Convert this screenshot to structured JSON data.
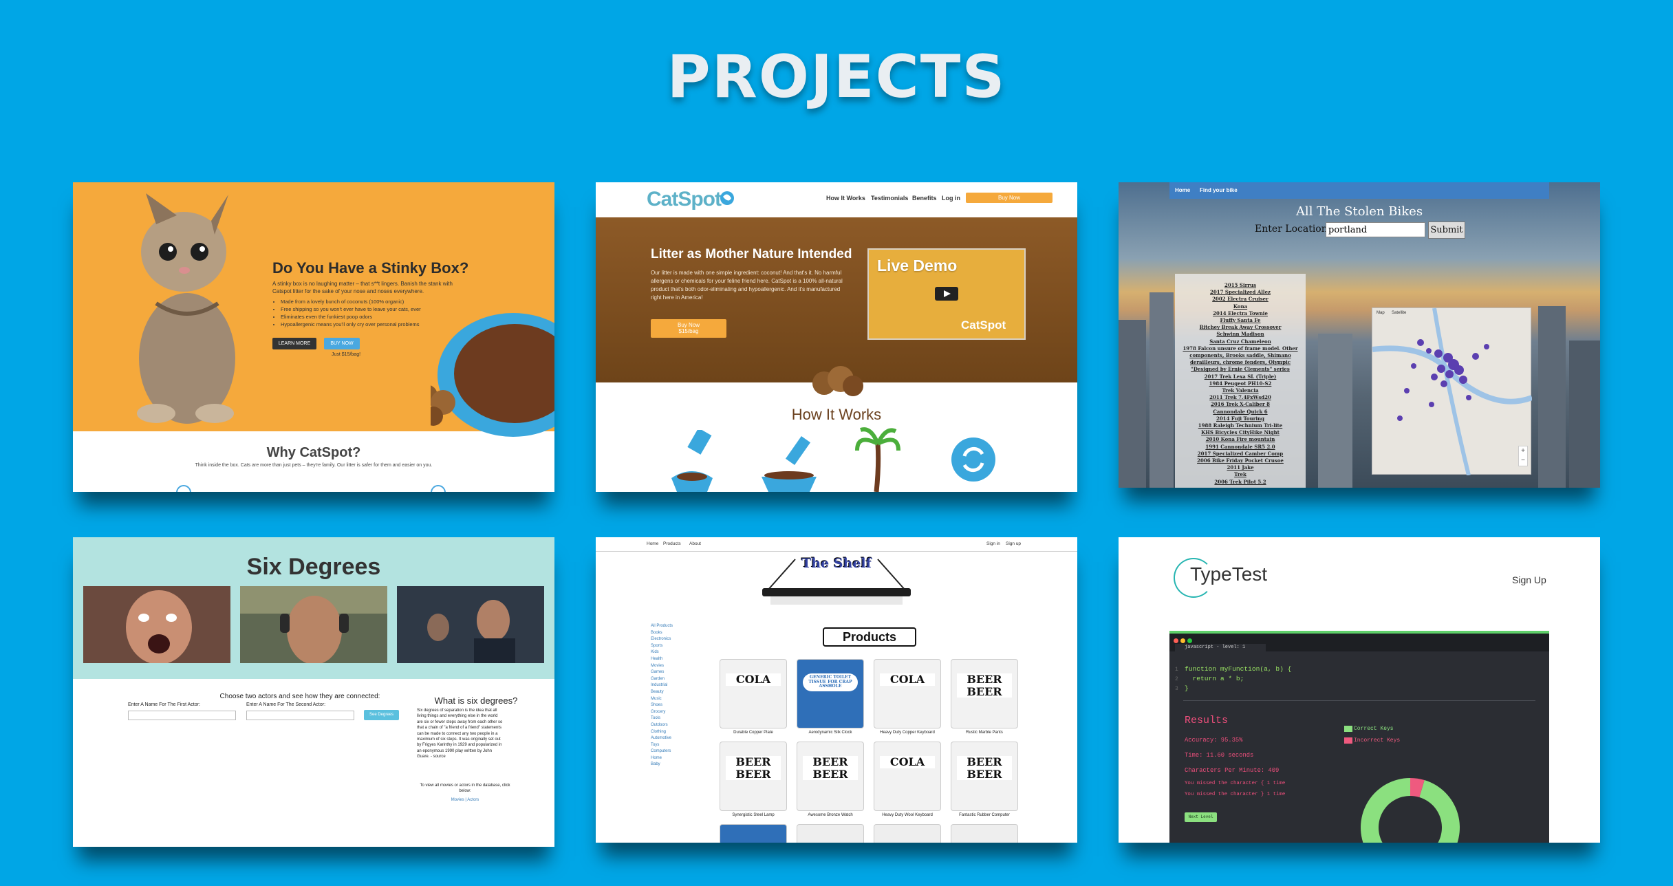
{
  "page": {
    "title": "PROJECTS"
  },
  "stinky": {
    "heading": "Do You Have a Stinky Box?",
    "para": "A stinky box is no laughing matter – that s**t lingers. Banish the stank with Catspot litter for the sake of your nose and noses everywhere.",
    "bullets": [
      "Made from a lovely bunch of coconuts (100% organic)",
      "Free shipping so you won't ever have to leave your cats, ever",
      "Eliminates even the funkiest poop odors",
      "Hypoallergenic means you'll only cry over personal problems"
    ],
    "learn_more": "LEARN MORE",
    "buy_now": "BUY NOW",
    "price": "Just $15/bag!",
    "why_title": "Why CatSpot?",
    "why_text": "Think inside the box. Cats are more than just pets – they're family. Our litter is safer for them and easier on you."
  },
  "catspot": {
    "logo": "CatSpot",
    "nav": [
      "How It Works",
      "Testimonials",
      "Benefits",
      "Log in"
    ],
    "buy_now": "Buy Now",
    "hero_title": "Litter as Mother Nature Intended",
    "hero_text": "Our litter is made with one simple ingredient: coconut! And that's it. No harmful allergens or chemicals for your feline friend here. CatSpot is a 100% all-natural product that's both odor-eliminating and hypoallergenic. And it's manufactured right here in America!",
    "hero_btn": "Buy Now",
    "hero_btn_sub": "$15/bag",
    "video_title": "Live Demo",
    "video_logo": "CatSpot",
    "how_title": "How It Works"
  },
  "bikes": {
    "nav": [
      "Home",
      "Find your bike"
    ],
    "title": "All The Stolen Bikes",
    "location_label": "Enter Location",
    "location_value": "portland",
    "submit": "Submit",
    "list": [
      "2015 Sirrus",
      "2017 Specialized Allez",
      "2002 Electra Cruiser",
      "Kona",
      "2014 Electra Townie",
      "Fluffy Santa Fe",
      "Ritchey Break Away Crossover",
      "Schwinn Madison",
      "Santa Cruz Chameleon",
      "1978 Falcon unsure of frame model. Other",
      "components, Brooks saddle, Shimano",
      "derailleurs, chrome fenders, Olympic",
      "\"Designed by Ernie Clements\" series",
      "2017 Trek Lexa SL (Triple)",
      "1984 Peugeot PH10-S2",
      "Trek Valencia",
      "2011 Trek 7.4FxWsd20",
      "2016 Trek X-Caliber 8",
      "Cannondale Quick 6",
      "2014 Fuji Touring",
      "1988 Raleigh Technium Tri-lite",
      "KHS Bicycles CityHike Night",
      "2010 Kona Fire mountain",
      "1991 Cannondale SR5 2.0",
      "2017 Specialized Camber Comp",
      "2006 Bike Friday Pocket Crusoe",
      "2011 Jake",
      "Trek",
      "2006 Trek Pilot 5.2"
    ],
    "map_tabs": [
      "Map",
      "Satellite"
    ]
  },
  "sixdeg": {
    "title": "Six Degrees",
    "lead": "Choose two actors and see how they are connected:",
    "label1": "Enter A Name For The First Actor:",
    "label2": "Enter A Name For The Second Actor:",
    "go": "See Degrees",
    "what_title": "What is six degrees?",
    "what_text": "Six degrees of separation is the idea that all living things and everything else in the world are six or fewer steps away from each other so that a chain of \"a friend of a friend\" statements can be made to connect any two people in a maximum of six steps. It was originally set out by Frigyes Karinthy in 1929 and popularized in an eponymous 1990 play written by John Guare. - source",
    "view_text": "To view all movies or actors in the database, click below:",
    "view_links": "Movies | Actors"
  },
  "shelf": {
    "nav_left": [
      "Home",
      "Products",
      "About"
    ],
    "nav_right": [
      "Sign in",
      "Sign up"
    ],
    "title": "The Shelf",
    "products_title": "Products",
    "categories": [
      "All Products",
      "",
      "Books",
      "Electronics",
      "Sports",
      "Kids",
      "Health",
      "Movies",
      "Games",
      "Garden",
      "Industrial",
      "Beauty",
      "Music",
      "Shoes",
      "Grocery",
      "Tools",
      "Outdoors",
      "Clothing",
      "Automotive",
      "Toys",
      "Computers",
      "Home",
      "Baby"
    ],
    "items": [
      {
        "name": "Durable Copper Plate",
        "label": "COLA"
      },
      {
        "name": "Aerodynamic Silk Clock",
        "label": "GENERIC TOILET TISSUE FOR CRAP ASSHOLE"
      },
      {
        "name": "Heavy Duty Copper Keyboard",
        "label": "COLA"
      },
      {
        "name": "Rustic Marble Pants",
        "label": "BEER BEER"
      },
      {
        "name": "Synergistic Steel Lamp",
        "label": "BEER BEER"
      },
      {
        "name": "Awesome Bronze Watch",
        "label": "BEER BEER"
      },
      {
        "name": "Heavy Duty Wool Keyboard",
        "label": "COLA"
      },
      {
        "name": "Fantastic Rubber Computer",
        "label": "BEER BEER"
      }
    ]
  },
  "typetest": {
    "logo": "TypeTest",
    "signup": "Sign Up",
    "tab": "javascript - level: 1",
    "code": [
      "function myFunction(a, b) {",
      "  return a * b;",
      "}"
    ],
    "line_numbers": [
      "1",
      "2",
      "3"
    ],
    "results_title": "Results",
    "accuracy": "Accuracy: 95.35%",
    "time": "Time: 11.60 seconds",
    "cpm": "Characters Per Minute: 409",
    "miss1": "You missed the character { 1 time",
    "miss2": "You missed the character } 1 time",
    "next": "Next Level",
    "legend_correct": "Correct Keys",
    "legend_incorrect": "Incorrect Keys",
    "colors": {
      "correct": "#8be07f",
      "incorrect": "#ef5a7f"
    }
  },
  "chart_data": {
    "type": "pie",
    "categories": [
      "Correct Keys",
      "Incorrect Keys"
    ],
    "values": [
      95.35,
      4.65
    ]
  }
}
